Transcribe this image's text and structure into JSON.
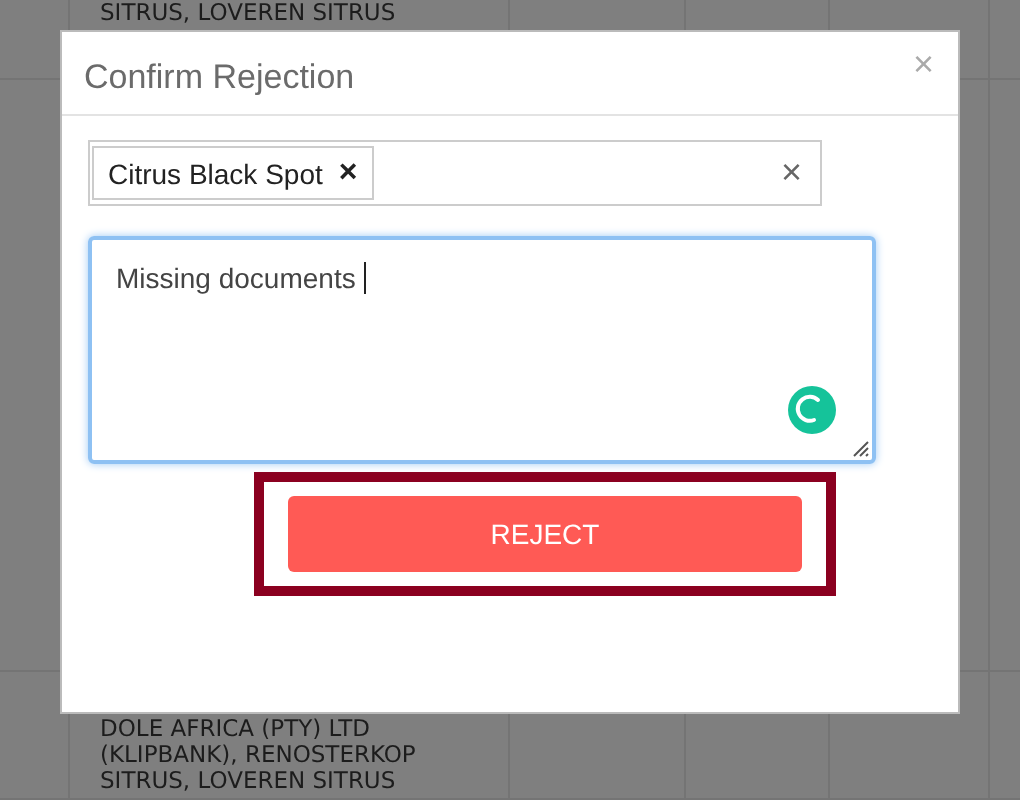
{
  "background_table": {
    "top_cell_lines": [
      "SITRUS, LOVEREN SITRUS"
    ],
    "bottom_cell_lines": [
      "DOLE AFRICA (PTY) LTD",
      "(KLIPBANK), RENOSTERKOP",
      "SITRUS, LOVEREN SITRUS"
    ]
  },
  "dialog": {
    "title": "Confirm Rejection",
    "close": "×",
    "reasons": {
      "tags": [
        {
          "label": "Citrus Black Spot",
          "remove": "×"
        }
      ],
      "clear": "×"
    },
    "comment": {
      "value": "Missing documents",
      "focused": true
    },
    "reject_button": {
      "label": "REJECT",
      "highlighted": true
    }
  }
}
